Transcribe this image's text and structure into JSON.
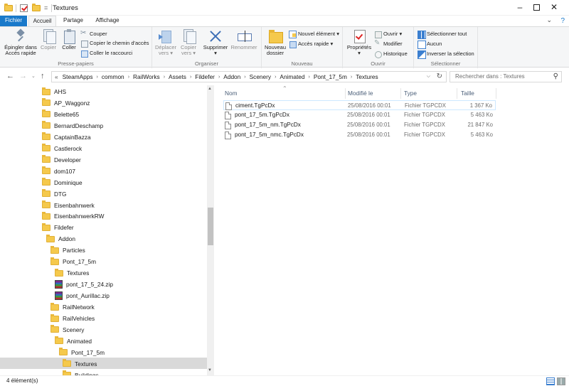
{
  "window": {
    "title": "Textures",
    "quick_access_dropdown": "="
  },
  "ribbon": {
    "tabs": [
      "Fichier",
      "Accueil",
      "Partage",
      "Affichage"
    ],
    "clipboard": {
      "label": "Presse-papiers",
      "pin_label_1": "Épingler dans",
      "pin_label_2": "Accès rapide",
      "copy_label": "Copier",
      "paste_label": "Coller",
      "cut_label": "Couper",
      "copy_path_label": "Copier le chemin d'accès",
      "paste_shortcut_label": "Coller le raccourci"
    },
    "organize": {
      "label": "Organiser",
      "move_label_1": "Déplacer",
      "move_label_2": "vers ▾",
      "copyto_label_1": "Copier",
      "copyto_label_2": "vers ▾",
      "delete_label": "Supprimer",
      "delete_caret": "▾",
      "rename_label": "Renommer"
    },
    "new": {
      "label": "Nouveau",
      "new_folder_label_1": "Nouveau",
      "new_folder_label_2": "dossier",
      "new_item_label": "Nouvel élément ▾",
      "easy_access_label": "Accès rapide ▾"
    },
    "open": {
      "label": "Ouvrir",
      "properties_label": "Propriétés",
      "properties_caret": "▾",
      "open_label": "Ouvrir ▾",
      "edit_label": "Modifier",
      "history_label": "Historique"
    },
    "select": {
      "label": "Sélectionner",
      "select_all_label": "Sélectionner tout",
      "select_none_label": "Aucun",
      "invert_label": "Inverser la sélection"
    }
  },
  "address": {
    "overflow": "«",
    "crumbs": [
      "SteamApps",
      "common",
      "RailWorks",
      "Assets",
      "Fildefer",
      "Addon",
      "Scenery",
      "Animated",
      "Pont_17_5m",
      "Textures"
    ],
    "search_placeholder": "Rechercher dans : Textures"
  },
  "tree": {
    "items": [
      {
        "label": "AHS",
        "type": "folder"
      },
      {
        "label": "AP_Waggonz",
        "type": "folder"
      },
      {
        "label": "Belette65",
        "type": "folder"
      },
      {
        "label": "BernardDeschamp",
        "type": "folder"
      },
      {
        "label": "CaptainBazza",
        "type": "folder"
      },
      {
        "label": "Castlerock",
        "type": "folder"
      },
      {
        "label": "Developer",
        "type": "folder"
      },
      {
        "label": "dom107",
        "type": "folder"
      },
      {
        "label": "Dominique",
        "type": "folder"
      },
      {
        "label": "DTG",
        "type": "folder"
      },
      {
        "label": "Eisenbahnwerk",
        "type": "folder"
      },
      {
        "label": "EisenbahnwerkRW",
        "type": "folder"
      },
      {
        "label": "Fildefer",
        "type": "folder"
      },
      {
        "label": "Addon",
        "type": "folder"
      },
      {
        "label": "Particles",
        "type": "folder"
      },
      {
        "label": "Pont_17_5m",
        "type": "folder"
      },
      {
        "label": "Textures",
        "type": "folder"
      },
      {
        "label": "pont_17_5_24.zip",
        "type": "zip"
      },
      {
        "label": "pont_Aurillac.zip",
        "type": "zip"
      },
      {
        "label": "RailNetwork",
        "type": "folder"
      },
      {
        "label": "RailVehicles",
        "type": "folder"
      },
      {
        "label": "Scenery",
        "type": "folder"
      },
      {
        "label": "Animated",
        "type": "folder"
      },
      {
        "label": "Pont_17_5m",
        "type": "folder"
      },
      {
        "label": "Textures",
        "type": "folder"
      },
      {
        "label": "Buildings",
        "type": "folder"
      }
    ]
  },
  "files": {
    "columns": [
      "Nom",
      "Modifié le",
      "Type",
      "Taille"
    ],
    "rows": [
      {
        "name": "ciment.TgPcDx",
        "date": "25/08/2016 00:01",
        "type": "Fichier TGPCDX",
        "size": "1 367 Ko"
      },
      {
        "name": "pont_17_5m.TgPcDx",
        "date": "25/08/2016 00:01",
        "type": "Fichier TGPCDX",
        "size": "5 463 Ko"
      },
      {
        "name": "pont_17_5m_nm.TgPcDx",
        "date": "25/08/2016 00:01",
        "type": "Fichier TGPCDX",
        "size": "21 847 Ko"
      },
      {
        "name": "pont_17_5m_nmc.TgPcDx",
        "date": "25/08/2016 00:01",
        "type": "Fichier TGPCDX",
        "size": "5 463 Ko"
      }
    ]
  },
  "status": {
    "count": "4 élément(s)"
  },
  "colors": {
    "file_tab": "#1979ca",
    "folder": "#f5c94c",
    "selection": "#d9d9d9"
  }
}
